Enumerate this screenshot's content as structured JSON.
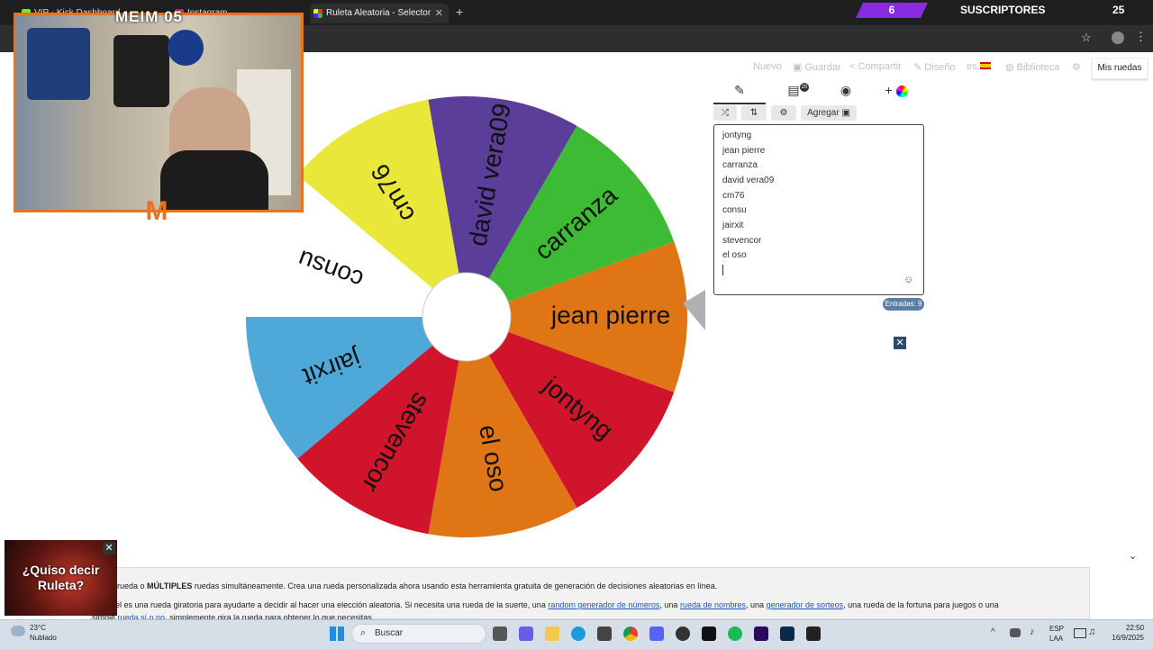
{
  "browser": {
    "tabs": [
      {
        "label": "VIP - Kick Dashboard"
      },
      {
        "label": "Instagram"
      },
      {
        "label": "Ruleta Aleatoria - Selector Perso..."
      }
    ],
    "new_tab": "+"
  },
  "overlay": {
    "webcam_title": "MEIM 05",
    "subscribers_count": "6",
    "subscribers_label": "SUSCRIPTORES",
    "subscribers_goal": "25"
  },
  "menu": {
    "items": [
      "Nuevo",
      "Guardar",
      "Compartir",
      "Diseño",
      "es",
      "Biblioteca"
    ],
    "my_wheels": "Mis ruedas"
  },
  "editor": {
    "add_label": "Agregar",
    "badge": "20",
    "entries": [
      "jontyng",
      "jean pierre",
      "carranza",
      "david vera09",
      "cm76",
      "consu",
      "jairxit",
      "stevencor",
      "el oso"
    ],
    "entries_count": "Entradas: 9"
  },
  "wheel": {
    "segments": [
      {
        "label": "jean pierre",
        "color": "#e07516"
      },
      {
        "label": "jontyng",
        "color": "#d0142c"
      },
      {
        "label": "el oso",
        "color": "#e07516"
      },
      {
        "label": "stevencor",
        "color": "#d0142c"
      },
      {
        "label": "jairxit",
        "color": "#4ea9d8"
      },
      {
        "label": "consu",
        "color": "#ffffff"
      },
      {
        "label": "cm76",
        "color": "#e9e83a"
      },
      {
        "label": "david vera09",
        "color": "#5b3d9a"
      },
      {
        "label": "carranza",
        "color": "#3dbb34"
      }
    ]
  },
  "ad": {
    "line1": "¿Quiso decir",
    "line2": "Ruleta?"
  },
  "info": {
    "l1_pre": "rueda o ",
    "l1_bold": "MÚLTIPLES",
    "l1_post": " ruedas simultáneamente. Crea una rueda personalizada ahora usando esta herramienta gratuita de generación de decisiones aleatorias en línea.",
    "l2_a": "e Wheel es una rueda giratoria para ayudarte a decidir al hacer una elección aleatoria. Si necesita una rueda de la suerte, una ",
    "l2_link1": "random generador de números",
    "l2_b": ", una ",
    "l2_link2": "rueda de nombres",
    "l2_c": ", una ",
    "l2_link3": "generador de sorteos",
    "l2_d": ", una rueda de la fortuna para juegos o una",
    "l3_a": "simple ",
    "l3_link": "rueda sí o no",
    "l3_b": ", simplemente gira la rueda para obtener lo que necesitas."
  },
  "taskbar": {
    "temp": "23°C",
    "weather": "Nublado",
    "search": "Buscar",
    "lang1": "ESP",
    "lang2": "LAA",
    "time": "22:50",
    "date": "16/9/2025"
  }
}
